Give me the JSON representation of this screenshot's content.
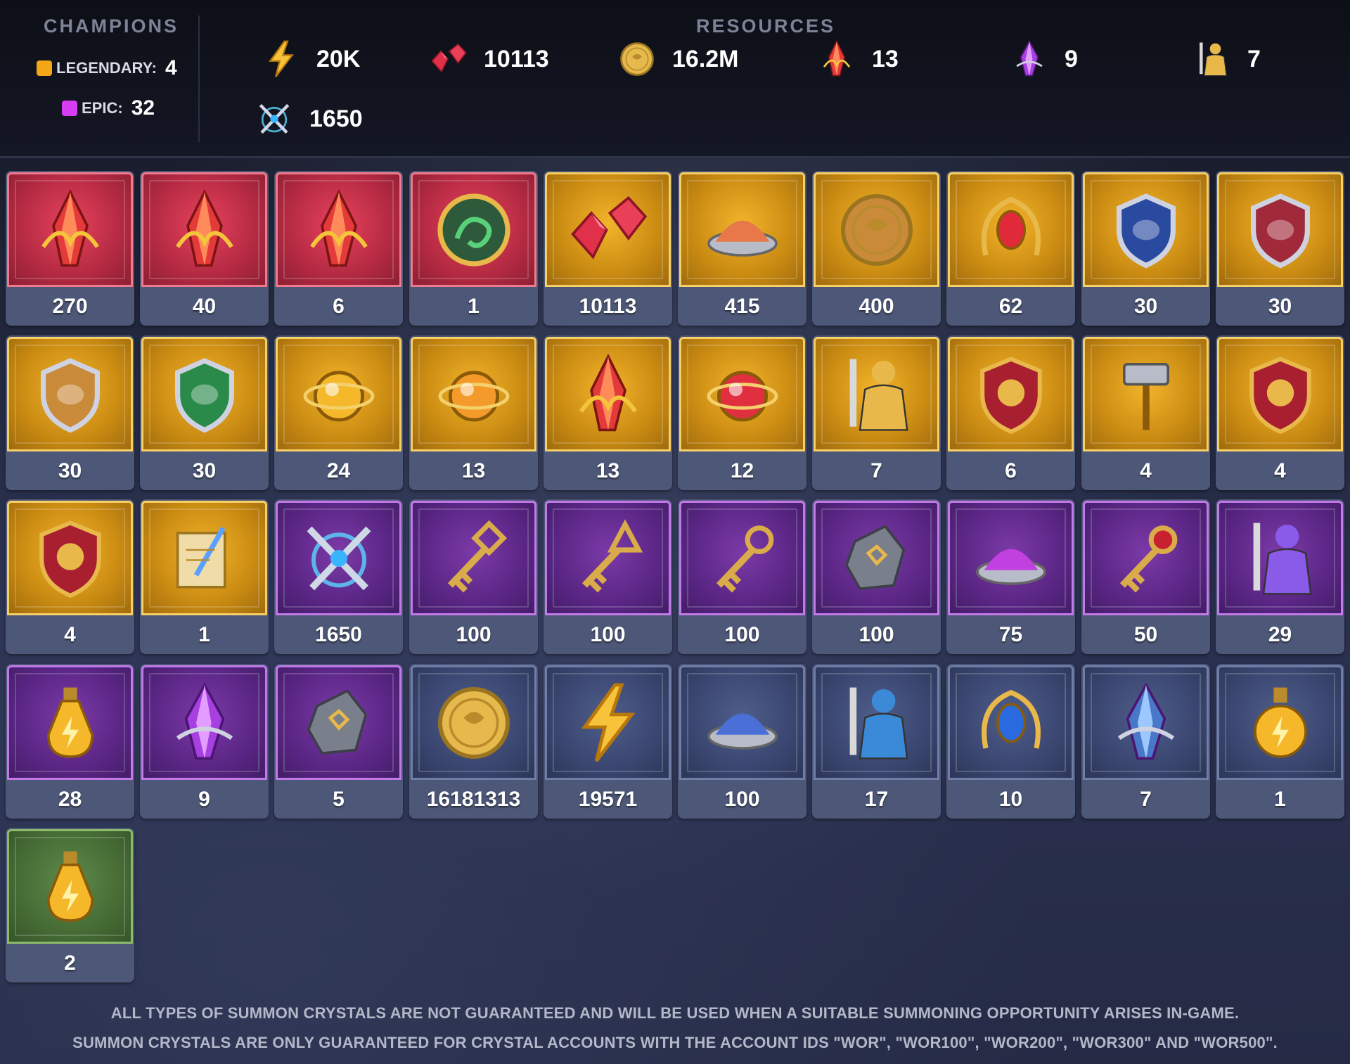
{
  "champions": {
    "title": "CHAMPIONS",
    "legendary_label": "LEGENDARY:",
    "legendary_value": "4",
    "legendary_color": "#f2a618",
    "epic_label": "EPIC:",
    "epic_value": "32",
    "epic_color": "#d63cf2"
  },
  "resources": {
    "title": "RESOURCES",
    "items": [
      {
        "icon": "energy-bolt-icon",
        "value": "20K"
      },
      {
        "icon": "ruby-gems-icon",
        "value": "10113"
      },
      {
        "icon": "silver-coin-icon",
        "value": "16.2M"
      },
      {
        "icon": "sacred-shard-icon",
        "value": "13"
      },
      {
        "icon": "void-shard-icon",
        "value": "9"
      },
      {
        "icon": "gold-champion-icon",
        "value": "7"
      },
      {
        "icon": "crossed-swords-icon",
        "value": "1650"
      }
    ]
  },
  "inventory": [
    {
      "rarity": "red",
      "icon": "red-crystal-shard-icon",
      "count": "270"
    },
    {
      "rarity": "red",
      "icon": "red-crystal-cluster-icon",
      "count": "40"
    },
    {
      "rarity": "red",
      "icon": "red-prism-crystal-icon",
      "count": "6"
    },
    {
      "rarity": "red",
      "icon": "chameleon-medallion-icon",
      "count": "1"
    },
    {
      "rarity": "gold",
      "icon": "ruby-gems-icon",
      "count": "10113"
    },
    {
      "rarity": "gold",
      "icon": "ember-dust-bowl-icon",
      "count": "415"
    },
    {
      "rarity": "gold",
      "icon": "bronze-emblem-coin-icon",
      "count": "400"
    },
    {
      "rarity": "gold",
      "icon": "ruby-flame-amulet-icon",
      "count": "62"
    },
    {
      "rarity": "gold",
      "icon": "blue-potion-shield-icon",
      "count": "30"
    },
    {
      "rarity": "gold",
      "icon": "red-potion-shield-icon",
      "count": "30"
    },
    {
      "rarity": "gold",
      "icon": "gold-potion-shield-icon",
      "count": "30"
    },
    {
      "rarity": "gold",
      "icon": "green-potion-shield-icon",
      "count": "30"
    },
    {
      "rarity": "gold",
      "icon": "golden-orb-icon",
      "count": "24"
    },
    {
      "rarity": "gold",
      "icon": "golden-armillary-icon",
      "count": "13"
    },
    {
      "rarity": "gold",
      "icon": "sacred-shard-icon",
      "count": "13"
    },
    {
      "rarity": "gold",
      "icon": "ruby-flame-orb-icon",
      "count": "12"
    },
    {
      "rarity": "gold",
      "icon": "gold-knight-icon",
      "count": "7"
    },
    {
      "rarity": "gold",
      "icon": "sun-shield-crest-icon",
      "count": "6"
    },
    {
      "rarity": "gold",
      "icon": "hammer-icon",
      "count": "4"
    },
    {
      "rarity": "gold",
      "icon": "strongman-crest-icon",
      "count": "4"
    },
    {
      "rarity": "gold",
      "icon": "sword-shield-crest-icon",
      "count": "4"
    },
    {
      "rarity": "gold",
      "icon": "scroll-quill-icon",
      "count": "1"
    },
    {
      "rarity": "purple",
      "icon": "crossed-swords-icon",
      "count": "1650"
    },
    {
      "rarity": "purple",
      "icon": "diamond-key-icon",
      "count": "100"
    },
    {
      "rarity": "purple",
      "icon": "triangle-key-icon",
      "count": "100"
    },
    {
      "rarity": "purple",
      "icon": "round-key-icon",
      "count": "100"
    },
    {
      "rarity": "purple",
      "icon": "arcane-stone-icon",
      "count": "100"
    },
    {
      "rarity": "purple",
      "icon": "violet-dust-bowl-icon",
      "count": "75"
    },
    {
      "rarity": "purple",
      "icon": "ruby-key-icon",
      "count": "50"
    },
    {
      "rarity": "purple",
      "icon": "violet-knight-icon",
      "count": "29"
    },
    {
      "rarity": "purple",
      "icon": "gold-potion-flask-icon",
      "count": "28"
    },
    {
      "rarity": "purple",
      "icon": "void-shard-icon",
      "count": "9"
    },
    {
      "rarity": "purple",
      "icon": "rune-stone-icon",
      "count": "5"
    },
    {
      "rarity": "blue",
      "icon": "silver-coin-icon",
      "count": "16181313"
    },
    {
      "rarity": "blue",
      "icon": "energy-bolt-icon",
      "count": "19571"
    },
    {
      "rarity": "blue",
      "icon": "blue-dust-bowl-icon",
      "count": "100"
    },
    {
      "rarity": "blue",
      "icon": "blue-knight-icon",
      "count": "17"
    },
    {
      "rarity": "blue",
      "icon": "sapphire-amulet-icon",
      "count": "10"
    },
    {
      "rarity": "blue",
      "icon": "mystery-shard-icon",
      "count": "7"
    },
    {
      "rarity": "blue",
      "icon": "round-potion-icon",
      "count": "1"
    },
    {
      "rarity": "green",
      "icon": "small-potion-icon",
      "count": "2"
    }
  ],
  "footer": {
    "line1": "ALL TYPES OF SUMMON CRYSTALS ARE NOT GUARANTEED AND WILL BE USED WHEN A SUITABLE SUMMONING OPPORTUNITY ARISES IN-GAME.",
    "line2": "SUMMON CRYSTALS ARE ONLY GUARANTEED FOR CRYSTAL ACCOUNTS WITH THE ACCOUNT IDS \"WOR\", \"WOR100\", \"WOR200\", \"WOR300\" AND \"WOR500\"."
  },
  "colors": {
    "red": "#c0304a",
    "gold": "#d99a18",
    "purple": "#6a2e98",
    "blue": "#3f4b76",
    "green": "#4e7a3c"
  }
}
